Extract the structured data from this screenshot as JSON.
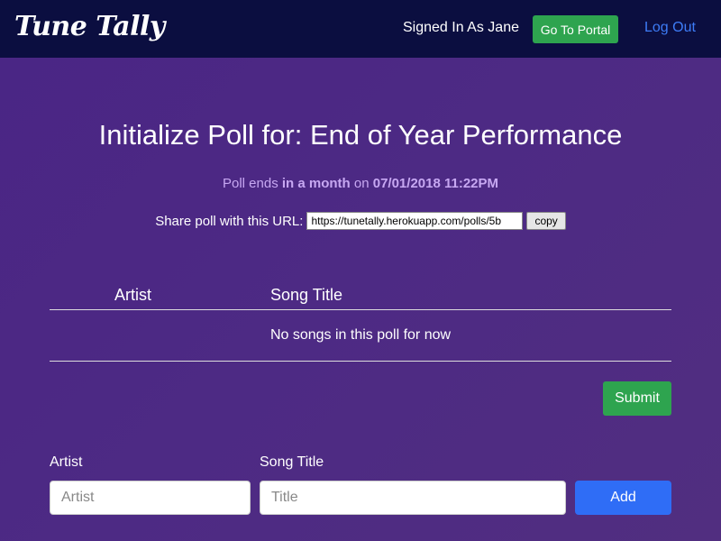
{
  "navbar": {
    "brand": "Tune Tally",
    "signed_in_text": "Signed In As Jane",
    "portal_button": "Go To Portal",
    "logout_link": "Log Out"
  },
  "poll": {
    "title": "Initialize Poll for: End of Year Performance",
    "ends_prefix": "Poll ends",
    "ends_relative": "in a month",
    "ends_on": "on",
    "ends_datetime": "07/01/2018 11:22PM",
    "share_label": "Share poll with this URL:",
    "share_url": "https://tunetally.herokuapp.com/polls/5b",
    "copy_button": "copy"
  },
  "table": {
    "columns": [
      "Artist",
      "Song Title"
    ],
    "empty_message": "No songs in this poll for now",
    "submit_button": "Submit"
  },
  "add_form": {
    "artist_label": "Artist",
    "artist_placeholder": "Artist",
    "song_label": "Song Title",
    "song_placeholder": "Title",
    "add_button": "Add"
  },
  "colors": {
    "navbar_bg": "#0b0e40",
    "page_bg": "#4d2a84",
    "accent_green": "#2ea44f",
    "accent_blue": "#2f6df6",
    "link_blue": "#3d7cf7",
    "muted_purple": "#c7a8f2"
  }
}
